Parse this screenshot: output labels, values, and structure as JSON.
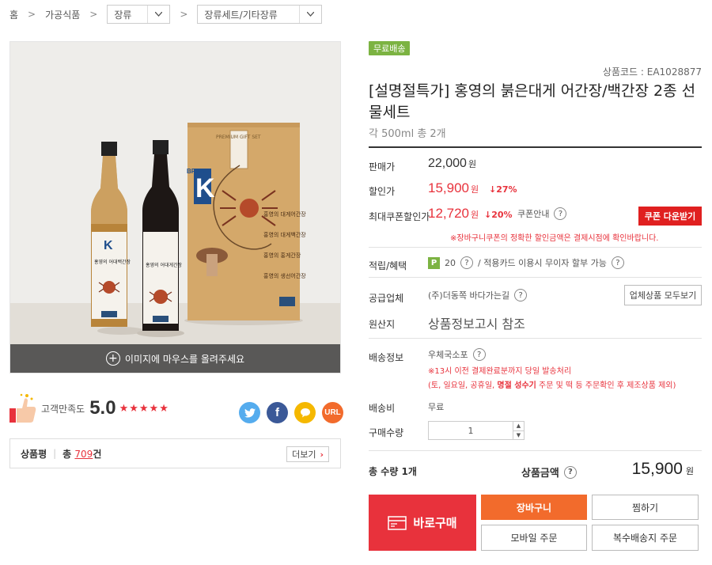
{
  "breadcrumb": {
    "home": "홈",
    "category1": "가공식품",
    "category2": "장류",
    "category3": "장류세트/기타장류"
  },
  "image": {
    "hover_text": "이미지에 마우스를 올려주세요",
    "bottle1_brand": "K",
    "bottle1_label": "홍영의 어대백간장",
    "bottle2_label": "홍영의 어대게간장",
    "box_brand": "K",
    "box_brand_word": "BRAND",
    "box_header": "PREMIUM GIFT SET",
    "box_lines": [
      "홍영의 대게어간장",
      "홍영의 대게백간장",
      "홍영의 홍게간장",
      "홍영의 생선어간장"
    ]
  },
  "satisfaction": {
    "label": "고객만족도",
    "score": "5.0",
    "stars": [
      "★",
      "★",
      "★",
      "★",
      "★"
    ]
  },
  "share": {
    "twitter": "t",
    "facebook": "f",
    "kakao": "",
    "url": "URL"
  },
  "reviews": {
    "title": "상품평",
    "total_prefix": "총",
    "count": "709",
    "unit": "건",
    "more_label": "더보기",
    "more_arrow": "›"
  },
  "product": {
    "badge": "무료배송",
    "code": "상품코드 : EA1028877",
    "title": "[설명절특가] 홍영의 붉은대게 어간장/백간장 2종 선물세트",
    "subtitle": "각 500ml 총 2개"
  },
  "pricing": {
    "sale_label": "판매가",
    "sale_price": "22,000",
    "won": "원",
    "discount_label": "할인가",
    "discount_price": "15,900",
    "discount_rate": "↓27%",
    "coupon_label": "최대쿠폰할인가",
    "coupon_price": "12,720",
    "coupon_rate": "↓20%",
    "coupon_guide": "쿠폰안내",
    "coupon_button": "쿠폰 다운받기",
    "coupon_note": "※장바구니쿠폰의 정확한 할인금액은 결제시점에 확인바랍니다."
  },
  "benefits": {
    "label": "적립/혜택",
    "point_badge": "P",
    "points": "20",
    "card_text": "/  적용카드 이용시 무이자 할부 가능"
  },
  "vendor": {
    "label": "공급업체",
    "name": "(주)더동쪽 바다가는길",
    "all_button": "업체상품 모두보기"
  },
  "origin": {
    "label": "원산지",
    "value": "상품정보고시 참조"
  },
  "shipping": {
    "label": "배송정보",
    "method": "우체국소포",
    "note1": "※13시 이전 결제완료분까지 당일 발송처리",
    "note2_pre": "(토, 일요일, 공휴일, ",
    "note2_bold": "명절 성수기",
    "note2_post": " 주문 및 떡 등 주문확인 후 제조상품 제외)"
  },
  "fee": {
    "label": "배송비",
    "value": "무료"
  },
  "quantity": {
    "label": "구매수량",
    "value": "1",
    "up": "▲",
    "down": "▼"
  },
  "total": {
    "qty_text": "총 수량 1개",
    "amount_label": "상품금액",
    "amount": "15,900",
    "won": "원"
  },
  "actions": {
    "buy_now": "바로구매",
    "cart": "장바구니",
    "wish": "찜하기",
    "mobile": "모바일 주문",
    "multi": "복수배송지 주문"
  },
  "help_mark": "?",
  "colors": {
    "accent_red": "#e8323c",
    "orange": "#f26b2c",
    "green": "#7cb342",
    "twitter": "#55acee",
    "facebook": "#3b5998",
    "kakao": "#f5b800",
    "url": "#f26b2c"
  }
}
